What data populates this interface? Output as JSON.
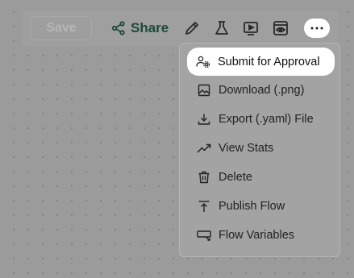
{
  "toolbar": {
    "save_label": "Save",
    "share_label": "Share",
    "icons": [
      "share-icon",
      "pencil-icon",
      "flask-icon",
      "play-screen-icon",
      "preview-eye-icon",
      "more-horizontal-icon"
    ]
  },
  "menu": {
    "items": [
      {
        "label": "Submit for Approval",
        "icon": "users-gear-icon",
        "highlighted": true
      },
      {
        "label": "Download (.png)",
        "icon": "image-icon"
      },
      {
        "label": "Export (.yaml) File",
        "icon": "download-icon"
      },
      {
        "label": "View Stats",
        "icon": "trending-up-icon"
      },
      {
        "label": "Delete",
        "icon": "trash-icon"
      },
      {
        "label": "Publish Flow",
        "icon": "upload-icon"
      },
      {
        "label": "Flow Variables",
        "icon": "variables-icon"
      }
    ]
  },
  "colors": {
    "overlay": "#9b9b9b",
    "share_text": "#1d4a3a",
    "highlight": "#ffffff"
  }
}
